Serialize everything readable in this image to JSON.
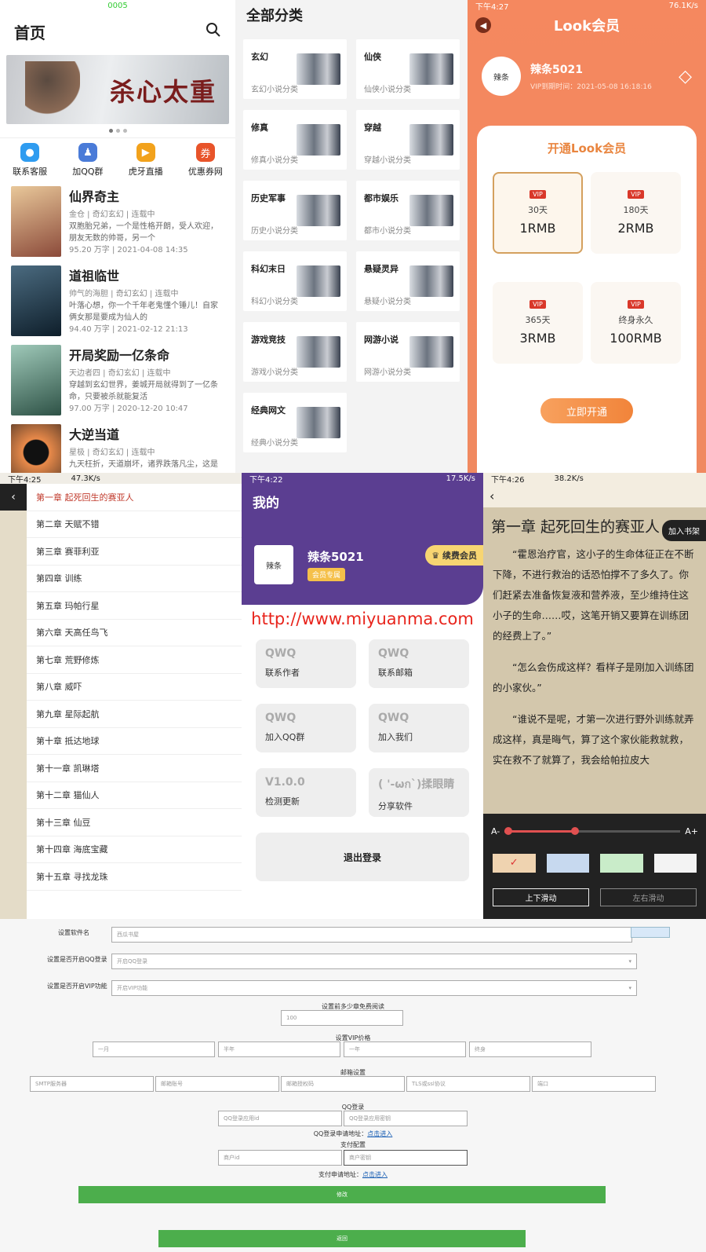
{
  "home": {
    "status": "0005",
    "title": "首页",
    "banner_text": "杀心太重",
    "quick": [
      {
        "label": "联系客服",
        "color": "#2f9cf0",
        "icon": "customer-service-icon"
      },
      {
        "label": "加QQ群",
        "color": "#4a7bd8",
        "icon": "qq-group-icon"
      },
      {
        "label": "虎牙直播",
        "color": "#f2a21c",
        "icon": "live-stream-icon"
      },
      {
        "label": "优惠券网",
        "color": "#e8542a",
        "icon": "coupon-icon"
      }
    ],
    "books": [
      {
        "title": "仙界奇主",
        "meta": "金仓 | 奇幻玄幻 | 连载中",
        "desc": "双胞胎兄弟，一个是性格开朗，受人欢迎，朋友无数的帅哥，另一个",
        "stats": "95.20 万字 | 2021-04-08 14:35",
        "cover": "#8b4a3a"
      },
      {
        "title": "道祖临世",
        "meta": "帅气的海胆 | 奇幻玄幻 | 连载中",
        "desc": "叶落心想，你一个千年老鬼懂个锤儿！自家俩女那是要成为仙人的",
        "stats": "94.40 万字 | 2021-02-12 21:13",
        "cover": "#1e3a4e"
      },
      {
        "title": "开局奖励一亿条命",
        "meta": "天边者四 | 奇幻玄幻 | 连载中",
        "desc": "穿越到玄幻世界，姜城开局就得到了一亿条命，只要被杀就能复活",
        "stats": "97.00 万字 | 2020-12-20 10:47",
        "cover": "#3e6a5a"
      },
      {
        "title": "大逆当道",
        "meta": "星极 | 奇幻玄幻 | 连载中",
        "desc": "九天枉折，天道崩坏，诸界跌落凡尘，这是一",
        "stats": "",
        "cover": "#c96f3c"
      }
    ]
  },
  "categories": {
    "title": "全部分类",
    "items": [
      {
        "name": "玄幻",
        "sub": "玄幻小说分类"
      },
      {
        "name": "仙侠",
        "sub": "仙侠小说分类"
      },
      {
        "name": "修真",
        "sub": "修真小说分类"
      },
      {
        "name": "穿越",
        "sub": "穿越小说分类"
      },
      {
        "name": "历史军事",
        "sub": "历史小说分类"
      },
      {
        "name": "都市娱乐",
        "sub": "都市小说分类"
      },
      {
        "name": "科幻末日",
        "sub": "科幻小说分类"
      },
      {
        "name": "悬疑灵异",
        "sub": "悬疑小说分类"
      },
      {
        "name": "游戏竞技",
        "sub": "游戏小说分类"
      },
      {
        "name": "网游小说",
        "sub": "网游小说分类"
      },
      {
        "name": "经典网文",
        "sub": "经典小说分类"
      }
    ]
  },
  "vip": {
    "status": "下午4:27",
    "net": "76.1K/s",
    "title": "Look会员",
    "user": "辣条5021",
    "expire": "VIP到期时间：2021-05-08 16:18:16",
    "card_title": "开通Look会员",
    "badge": "VIP",
    "plans": [
      {
        "days": "30天",
        "price": "1RMB",
        "selected": true
      },
      {
        "days": "180天",
        "price": "2RMB"
      },
      {
        "days": "365天",
        "price": "3RMB"
      },
      {
        "days": "终身永久",
        "price": "100RMB"
      }
    ],
    "buy": "立即开通",
    "avatar": "辣条"
  },
  "chapters": {
    "status": "下午4:25",
    "net": "47.3K/s",
    "items": [
      "第一章 起死回生的赛亚人",
      "第二章 天赋不错",
      "第三章 赛菲利亚",
      "第四章 训练",
      "第五章 玛帕行星",
      "第六章 天高任鸟飞",
      "第七章 荒野修炼",
      "第八章 威吓",
      "第九章 星际起航",
      "第十章 抵达地球",
      "第十一章 凯琳塔",
      "第十二章 猫仙人",
      "第十三章 仙豆",
      "第十四章 海底宝藏",
      "第十五章 寻找龙珠"
    ]
  },
  "mine": {
    "status": "下午4:22",
    "net": "17.5K/s",
    "title": "我的",
    "user": "辣条5021",
    "tag": "会员专属",
    "renew": "续费会员",
    "watermark": "http://www.miyuanma.com",
    "cards": [
      {
        "v": "QWQ",
        "l": "联系作者"
      },
      {
        "v": "QWQ",
        "l": "联系邮箱"
      },
      {
        "v": "QWQ",
        "l": "加入QQ群"
      },
      {
        "v": "QWQ",
        "l": "加入我们"
      },
      {
        "v": "V1.0.0",
        "l": "检测更新"
      },
      {
        "v": "( '-ωก`)揉眼睛",
        "l": "分享软件"
      }
    ],
    "logout": "退出登录",
    "avatar": "辣条"
  },
  "reader": {
    "status": "下午4:26",
    "net": "38.2K/s",
    "title": "第一章 起死回生的赛亚人",
    "add": "加入书架",
    "paras": [
      "“霍恩治疗官，这小子的生命体征正在不断下降，不进行救治的话恐怕撑不了多久了。你们赶紧去准备恢复液和营养液，至少维持住这小子的生命……哎，这笔开销又要算在训练团的经费上了。”",
      "“怎么会伤成这样？看样子是刚加入训练团的小家伙。”",
      "“谁说不是呢，才第一次进行野外训练就弄成这样，真是晦气，算了这个家伙能救就救，实在救不了就算了，我会给帕拉皮大"
    ],
    "font_minus": "A-",
    "font_plus": "A+",
    "font_level": 0.4,
    "check": "✓",
    "themes": [
      "#efd3b0",
      "#c7d9ef",
      "#c9ecc9",
      "#f3f3f3"
    ],
    "modes": [
      "上下滑动",
      "左右滑动"
    ]
  },
  "admin": {
    "name_label": "设置软件名",
    "name_value": "西瓜书屋",
    "qq_label": "设置是否开启QQ登录",
    "qq_value": "开启QQ登录",
    "vip_label": "设置是否开启VIP功能",
    "vip_value": "开启VIP功能",
    "free_label": "设置前多少章免费阅读",
    "free_value": "100",
    "price_label": "设置VIP价格",
    "price_ph": [
      "一月",
      "半年",
      "一年",
      "终身"
    ],
    "mail_label": "邮箱设置",
    "mail_ph": [
      "SMTP服务器",
      "邮箱账号",
      "邮箱授权码",
      "TLS或ssl协议",
      "端口"
    ],
    "qqlogin_label": "QQ登录",
    "qqlogin_ph": [
      "QQ登录应用id",
      "QQ登录应用密钥"
    ],
    "qqapply": "QQ登录申请地址：",
    "apply_link": "点击进入",
    "pay_label": "支付配置",
    "pay_ph": [
      "商户id",
      "商户密钥"
    ],
    "payapply": "支付申请地址：",
    "save": "修改",
    "back": "返回"
  }
}
